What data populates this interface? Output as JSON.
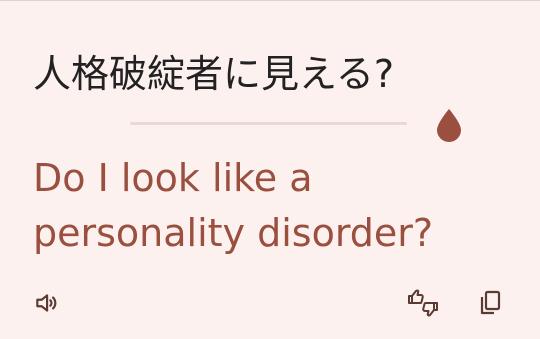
{
  "source": {
    "text": "人格破綻者に見える?"
  },
  "translation": {
    "text": "Do I look like a personality disorder?"
  },
  "actions": {
    "listen_icon": "speaker-icon",
    "feedback_icon": "thumbs-up-down-icon",
    "copy_icon": "copy-icon"
  },
  "colors": {
    "card_background": "#fcf1ef",
    "accent": "#9a4f3f",
    "source_text": "#222222",
    "icon": "#5a3a33"
  }
}
